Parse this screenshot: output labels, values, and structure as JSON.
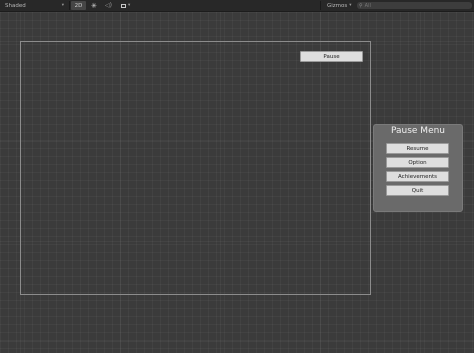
{
  "toolbar": {
    "shading_mode": "Shaded",
    "mode_2d": "2D",
    "gizmos_label": "Gizmos",
    "search_placeholder": "All"
  },
  "game": {
    "pause_button_label": "Pause"
  },
  "pause_menu": {
    "title": "Pause Menu",
    "items": [
      {
        "label": "Resume"
      },
      {
        "label": "Option"
      },
      {
        "label": "Achievements"
      },
      {
        "label": "Quit"
      }
    ]
  }
}
